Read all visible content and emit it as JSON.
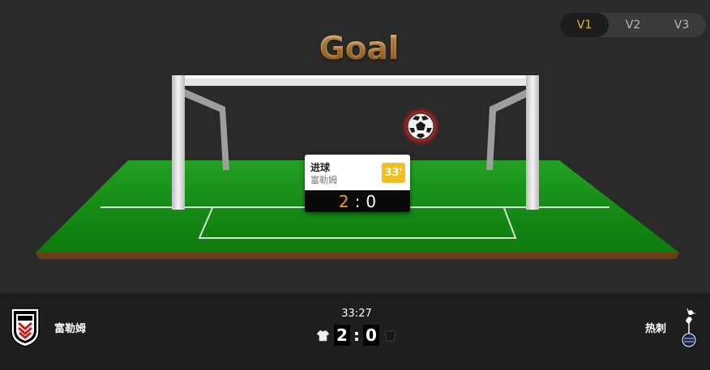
{
  "versions": [
    "V1",
    "V2",
    "V3"
  ],
  "active_version": "V1",
  "title": "Goal",
  "event": {
    "type": "进球",
    "team": "富勒姆",
    "minute": "33'",
    "home_score": "2",
    "away_score": "0",
    "separator": ":"
  },
  "match": {
    "clock": "33:27",
    "home": {
      "name": "富勒姆",
      "score": "2",
      "shirt_icon": "white-shirt-icon",
      "crest_icon": "fulham-crest-icon"
    },
    "away": {
      "name": "热刺",
      "score": "0",
      "shirt_icon": "black-shirt-icon",
      "crest_icon": "tottenham-crest-icon"
    },
    "separator": ":"
  },
  "colors": {
    "accent": "#f0b429",
    "grass": "#1a8a1a",
    "minute_badge": "#f7bd1c",
    "home_score": "#f0a020"
  }
}
